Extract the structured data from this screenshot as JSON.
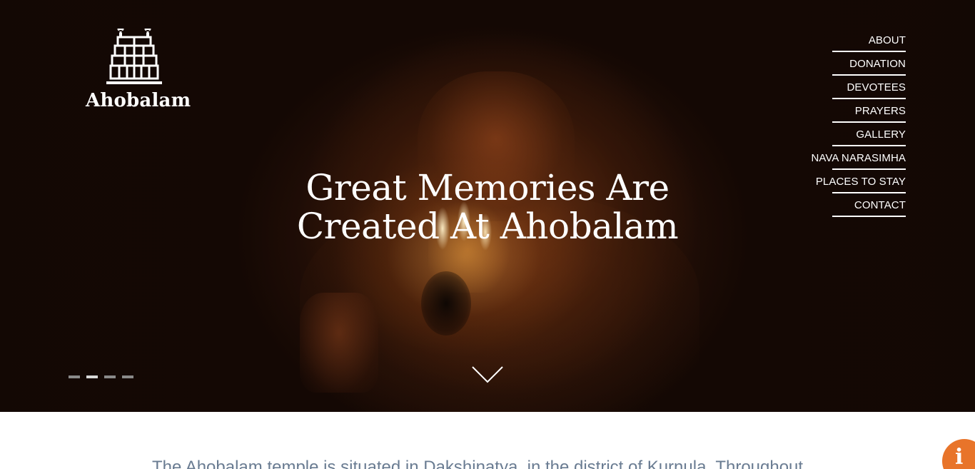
{
  "brand": {
    "name": "Ahobalam",
    "logo_icon": "temple-gopuram-icon"
  },
  "nav": {
    "items": [
      {
        "label": "ABOUT"
      },
      {
        "label": "DONATION"
      },
      {
        "label": "DEVOTEES"
      },
      {
        "label": "PRAYERS"
      },
      {
        "label": "GALLERY"
      },
      {
        "label": "NAVA NARASIMHA"
      },
      {
        "label": "PLACES TO STAY"
      },
      {
        "label": "CONTACT"
      }
    ]
  },
  "hero": {
    "headline_line1": "Great Memories Are",
    "headline_line2": "Created At Ahobalam",
    "slides": {
      "count": 4,
      "active_index": 1
    },
    "scroll_icon": "chevron-down-icon"
  },
  "intro": {
    "text": "The Ahobalam temple is situated in Dakshinatya, in the district of Kurnula. Throughout"
  },
  "info_button": {
    "icon": "info-icon",
    "glyph": "i"
  },
  "colors": {
    "accent": "#e8742a",
    "intro_text": "#6a7c92",
    "nav_text": "#ffffff"
  }
}
